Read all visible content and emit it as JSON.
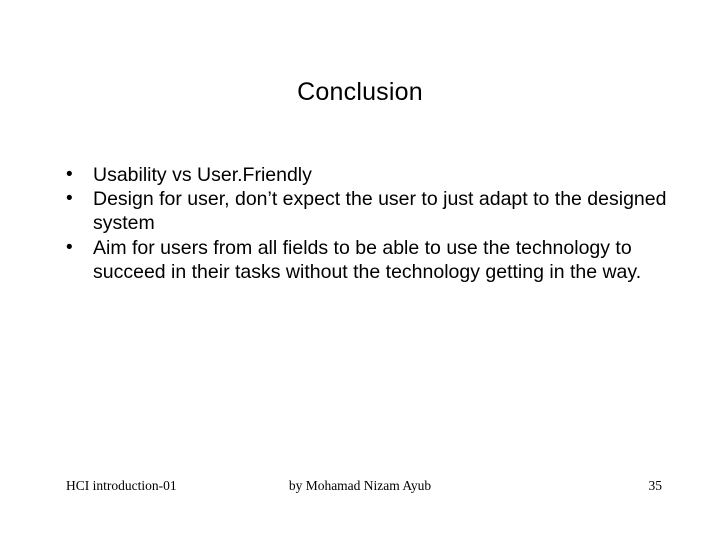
{
  "title": "Conclusion",
  "bullets": [
    "Usability vs User.Friendly",
    "Design for user, don’t expect the user to just adapt to the designed system",
    "Aim for users from all fields to be able to use the technology to succeed in their tasks without the technology getting in the way."
  ],
  "footer": {
    "left": "HCI introduction-01",
    "center": "by Mohamad Nizam Ayub",
    "right": "35"
  }
}
